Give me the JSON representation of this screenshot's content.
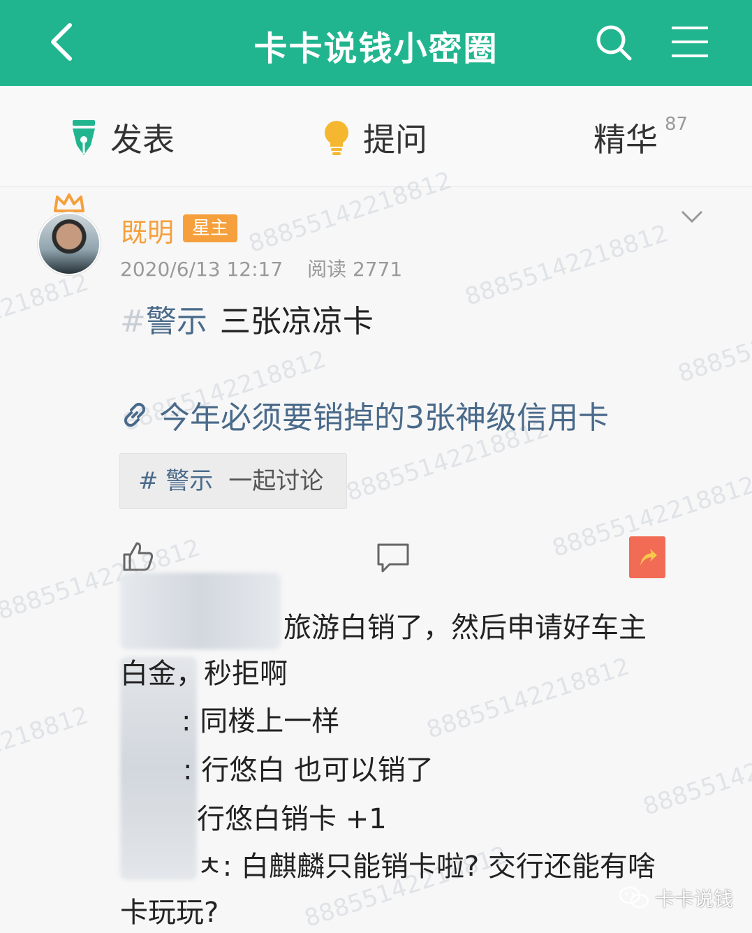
{
  "header": {
    "title": "卡卡说钱小密圈"
  },
  "actions": {
    "post": "发表",
    "ask": "提问",
    "digest": "精华",
    "digest_count": "87"
  },
  "post": {
    "author": "既明",
    "badge": "星主",
    "date": "2020/6/13 12:17",
    "reads": "阅读 2771",
    "topic_hash": "#",
    "topic_tag": "警示",
    "topic_text": "三张凉凉卡",
    "link_text": "今年必须要销掉的3张神级信用卡",
    "chip_tag": "# 警示",
    "chip_desc": "一起讨论"
  },
  "comments": {
    "c1a": "旅游白销了，然后申请好车主",
    "c1b": "白金，秒拒啊",
    "c2": ": 同楼上一样",
    "c3": ": 行悠白 也可以销了",
    "c4": "行悠白销卡 +1",
    "c5a": "ㅊ: 白麒麟只能销卡啦? 交行还能有啥",
    "c5b": "卡玩玩?"
  },
  "watermark": "88855142218812",
  "wechat_label": "卡卡说钱",
  "colors": {
    "brand": "#21b58f",
    "accent": "#f5a03c",
    "link": "#4a6a8a",
    "share": "#f26b55"
  }
}
